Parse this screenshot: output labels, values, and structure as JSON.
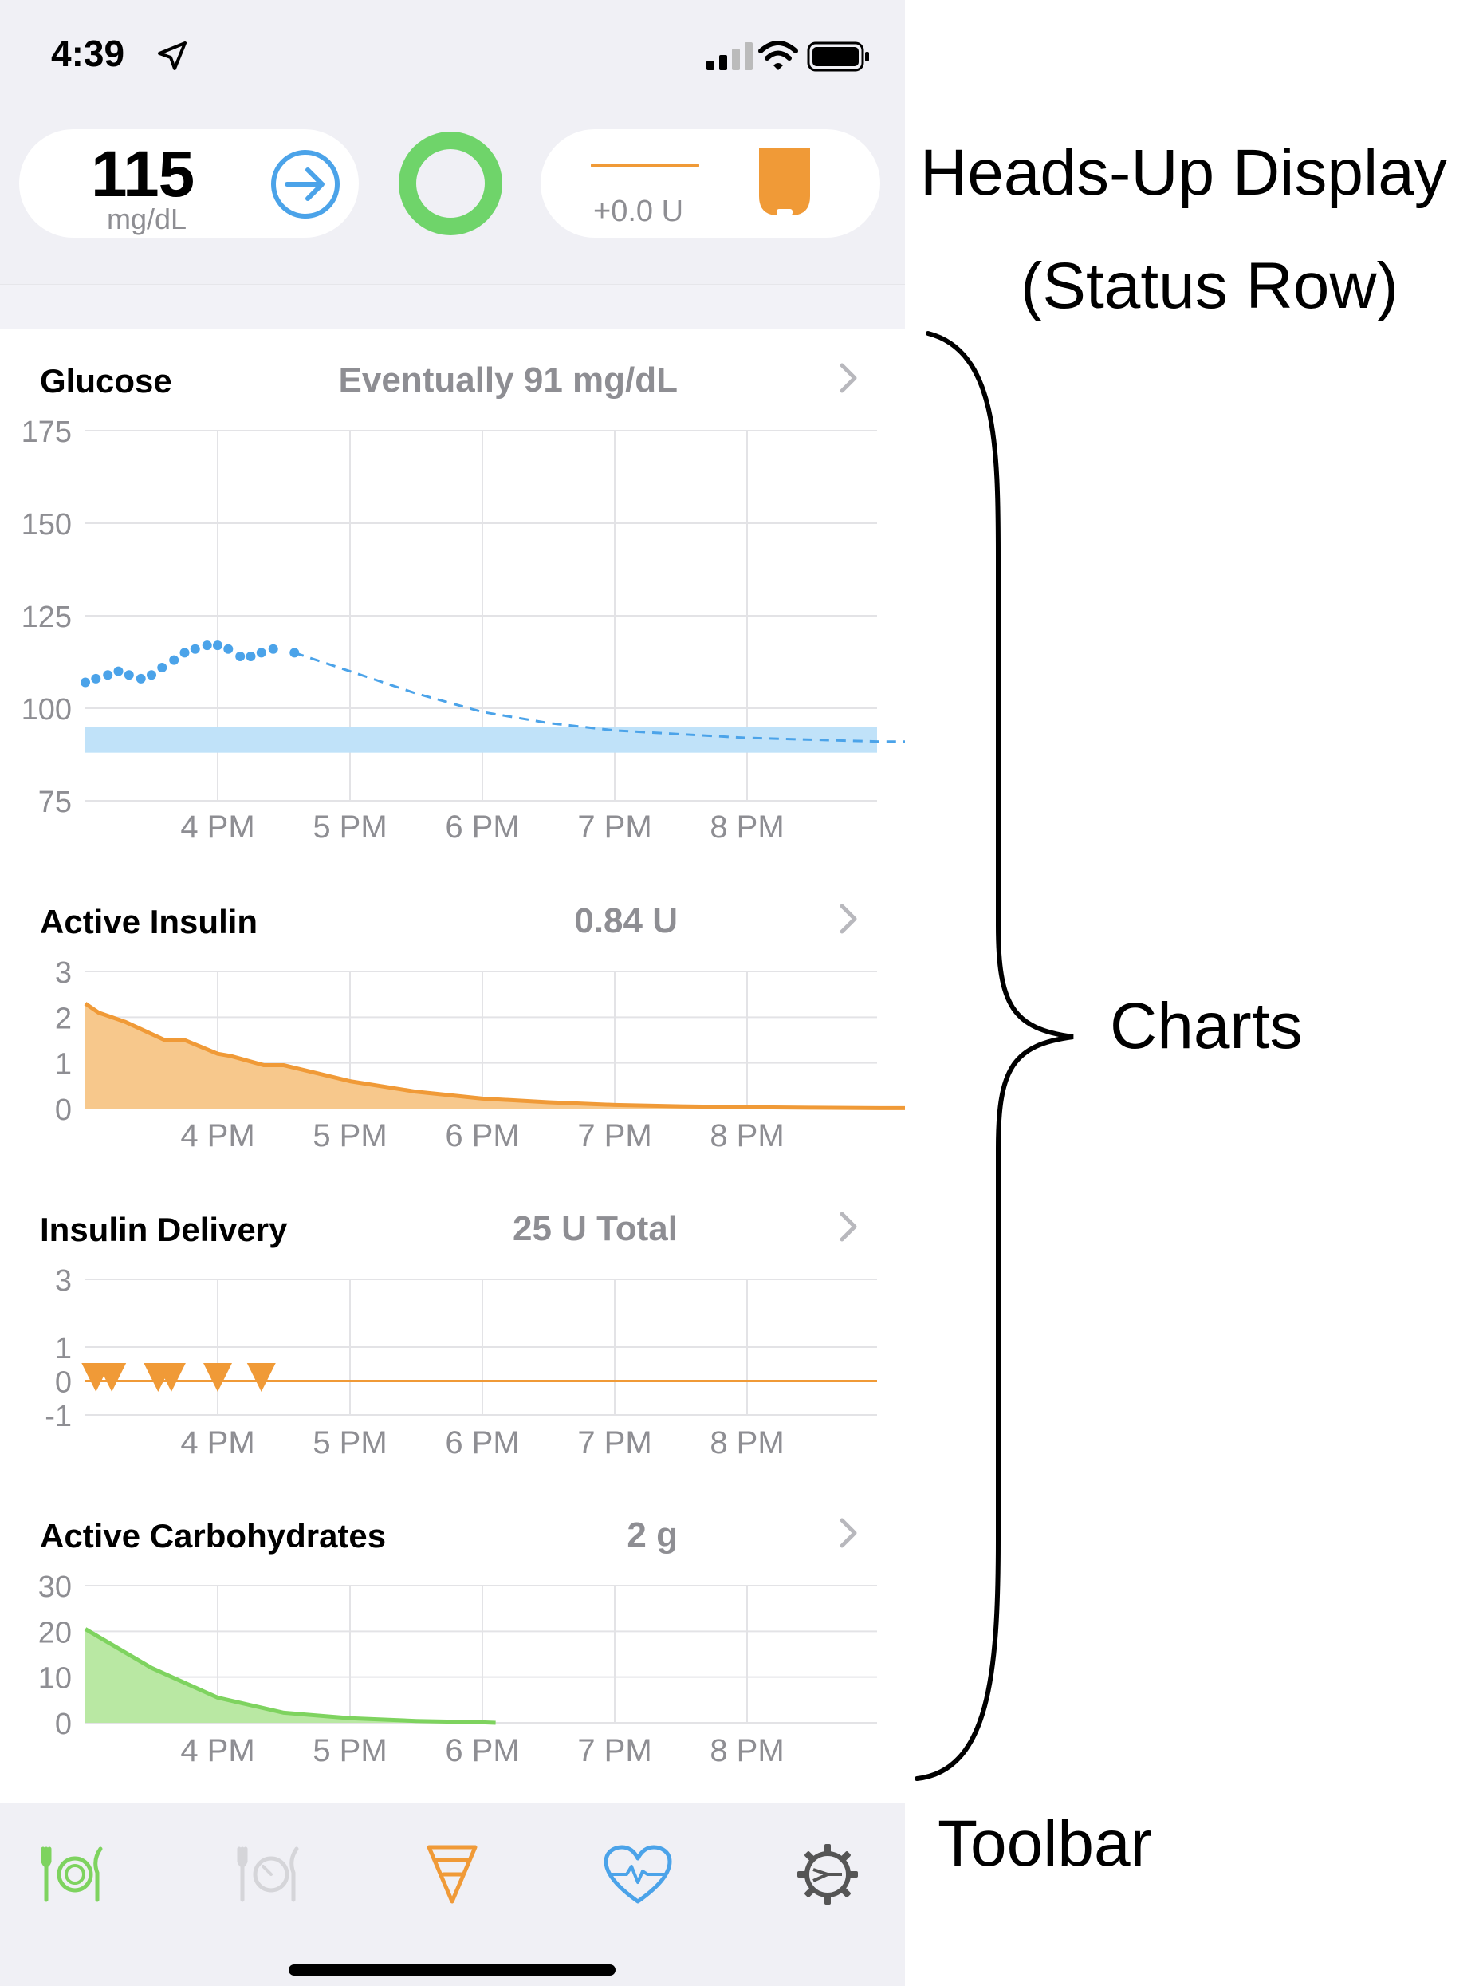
{
  "status_bar": {
    "time": "4:39"
  },
  "hud": {
    "glucose": {
      "value": "115",
      "unit": "mg/dL"
    },
    "reservoir": {
      "delivery": "+0.0 U"
    }
  },
  "charts": {
    "glucose": {
      "title": "Glucose",
      "value": "Eventually 91 mg/dL",
      "y_ticks": [
        "175",
        "150",
        "125",
        "100",
        "75"
      ],
      "x_ticks": [
        "4 PM",
        "5 PM",
        "6 PM",
        "7 PM",
        "8 PM"
      ]
    },
    "active_insulin": {
      "title": "Active Insulin",
      "value": "0.84 U",
      "y_ticks": [
        "3",
        "2",
        "1",
        "0"
      ],
      "x_ticks": [
        "4 PM",
        "5 PM",
        "6 PM",
        "7 PM",
        "8 PM"
      ]
    },
    "insulin_delivery": {
      "title": "Insulin Delivery",
      "value": "25 U Total",
      "y_ticks": [
        "3",
        "1",
        "0",
        "-1"
      ],
      "x_ticks": [
        "4 PM",
        "5 PM",
        "6 PM",
        "7 PM",
        "8 PM"
      ]
    },
    "active_carbs": {
      "title": "Active Carbohydrates",
      "value": "2 g",
      "y_ticks": [
        "30",
        "20",
        "10",
        "0"
      ],
      "x_ticks": [
        "4 PM",
        "5 PM",
        "6 PM",
        "7 PM",
        "8 PM"
      ]
    }
  },
  "chart_data": [
    {
      "type": "scatter",
      "name": "glucose",
      "x_hours": [
        15.0,
        15.08,
        15.17,
        15.25,
        15.33,
        15.42,
        15.5,
        15.58,
        15.67,
        15.75,
        15.83,
        15.92,
        16.0,
        16.08,
        16.17,
        16.25,
        16.33,
        16.42,
        16.58
      ],
      "values": [
        107,
        108,
        109,
        110,
        109,
        108,
        109,
        111,
        113,
        115,
        116,
        117,
        117,
        116,
        114,
        114,
        115,
        116,
        115
      ],
      "prediction": {
        "x_hours": [
          16.58,
          17.0,
          17.5,
          18.0,
          18.5,
          19.0,
          19.5,
          20.0,
          20.5,
          21.0,
          21.2
        ],
        "values": [
          115,
          110,
          104,
          99,
          96,
          94,
          93,
          92,
          91.5,
          91,
          91
        ]
      },
      "target_range": [
        88,
        95
      ],
      "ylim": [
        75,
        175
      ],
      "xlim_hours": [
        15.0,
        21.2
      ],
      "y_ticks": [
        175,
        150,
        125,
        100,
        75
      ],
      "x_ticks": [
        "4 PM",
        "5 PM",
        "6 PM",
        "7 PM",
        "8 PM"
      ],
      "grid": true,
      "colors": {
        "points": "#4ba3e9",
        "target": "#c0e2f9"
      }
    },
    {
      "type": "area",
      "name": "active_insulin",
      "x_hours": [
        15.0,
        15.1,
        15.3,
        15.6,
        15.75,
        16.0,
        16.1,
        16.35,
        16.5,
        17.0,
        17.5,
        18.0,
        18.5,
        19.0,
        19.5,
        20.0,
        20.5,
        21.0,
        21.2
      ],
      "values": [
        2.3,
        2.1,
        1.9,
        1.5,
        1.5,
        1.2,
        1.15,
        0.95,
        0.95,
        0.6,
        0.37,
        0.22,
        0.14,
        0.08,
        0.05,
        0.03,
        0.02,
        0.01,
        0.01
      ],
      "ylim": [
        0,
        3
      ],
      "xlim_hours": [
        15.0,
        21.2
      ],
      "y_ticks": [
        3,
        2,
        1,
        0
      ],
      "x_ticks": [
        "4 PM",
        "5 PM",
        "6 PM",
        "7 PM",
        "8 PM"
      ],
      "grid": true,
      "colors": {
        "line": "#f09a37",
        "fill": "#f7c88c"
      }
    },
    {
      "type": "scatter",
      "name": "insulin_delivery",
      "x_hours": [
        15.08,
        15.2,
        15.55,
        15.65,
        16.0,
        16.33
      ],
      "values": [
        0.2,
        0.2,
        0.2,
        0.2,
        0.2,
        0.2
      ],
      "marker": "triangle-down",
      "baseline": 0,
      "ylim": [
        -1,
        3
      ],
      "xlim_hours": [
        15.0,
        21.2
      ],
      "y_ticks": [
        3,
        1,
        0,
        -1
      ],
      "x_ticks": [
        "4 PM",
        "5 PM",
        "6 PM",
        "7 PM",
        "8 PM"
      ],
      "grid": true,
      "colors": {
        "marker": "#f09a37",
        "baseline": "#f09a37"
      }
    },
    {
      "type": "area",
      "name": "active_carbs",
      "x_hours": [
        15.0,
        15.5,
        16.0,
        16.5,
        17.0,
        17.5,
        18.0,
        18.1
      ],
      "values": [
        20.5,
        12,
        5.5,
        2.2,
        1.0,
        0.4,
        0.1,
        0.0
      ],
      "ylim": [
        0,
        30
      ],
      "xlim_hours": [
        15.0,
        21.2
      ],
      "y_ticks": [
        30,
        20,
        10,
        0
      ],
      "x_ticks": [
        "4 PM",
        "5 PM",
        "6 PM",
        "7 PM",
        "8 PM"
      ],
      "grid": true,
      "colors": {
        "line": "#7ed35f",
        "fill": "#b9e8a3"
      }
    }
  ],
  "annotations": {
    "hud_line1": "Heads-Up Display",
    "hud_line2": "(Status Row)",
    "charts": "Charts",
    "toolbar": "Toolbar"
  },
  "toolbar": {
    "icons": [
      "carbs-icon",
      "pre-meal-icon",
      "bolus-icon",
      "workout-icon",
      "settings-icon"
    ]
  },
  "colors": {
    "accent_blue": "#4ba3e9",
    "insulin_orange": "#f09a37",
    "carbs_green": "#7ed35f",
    "loop_green": "#6fd46a",
    "background": "#f0f0f5"
  }
}
